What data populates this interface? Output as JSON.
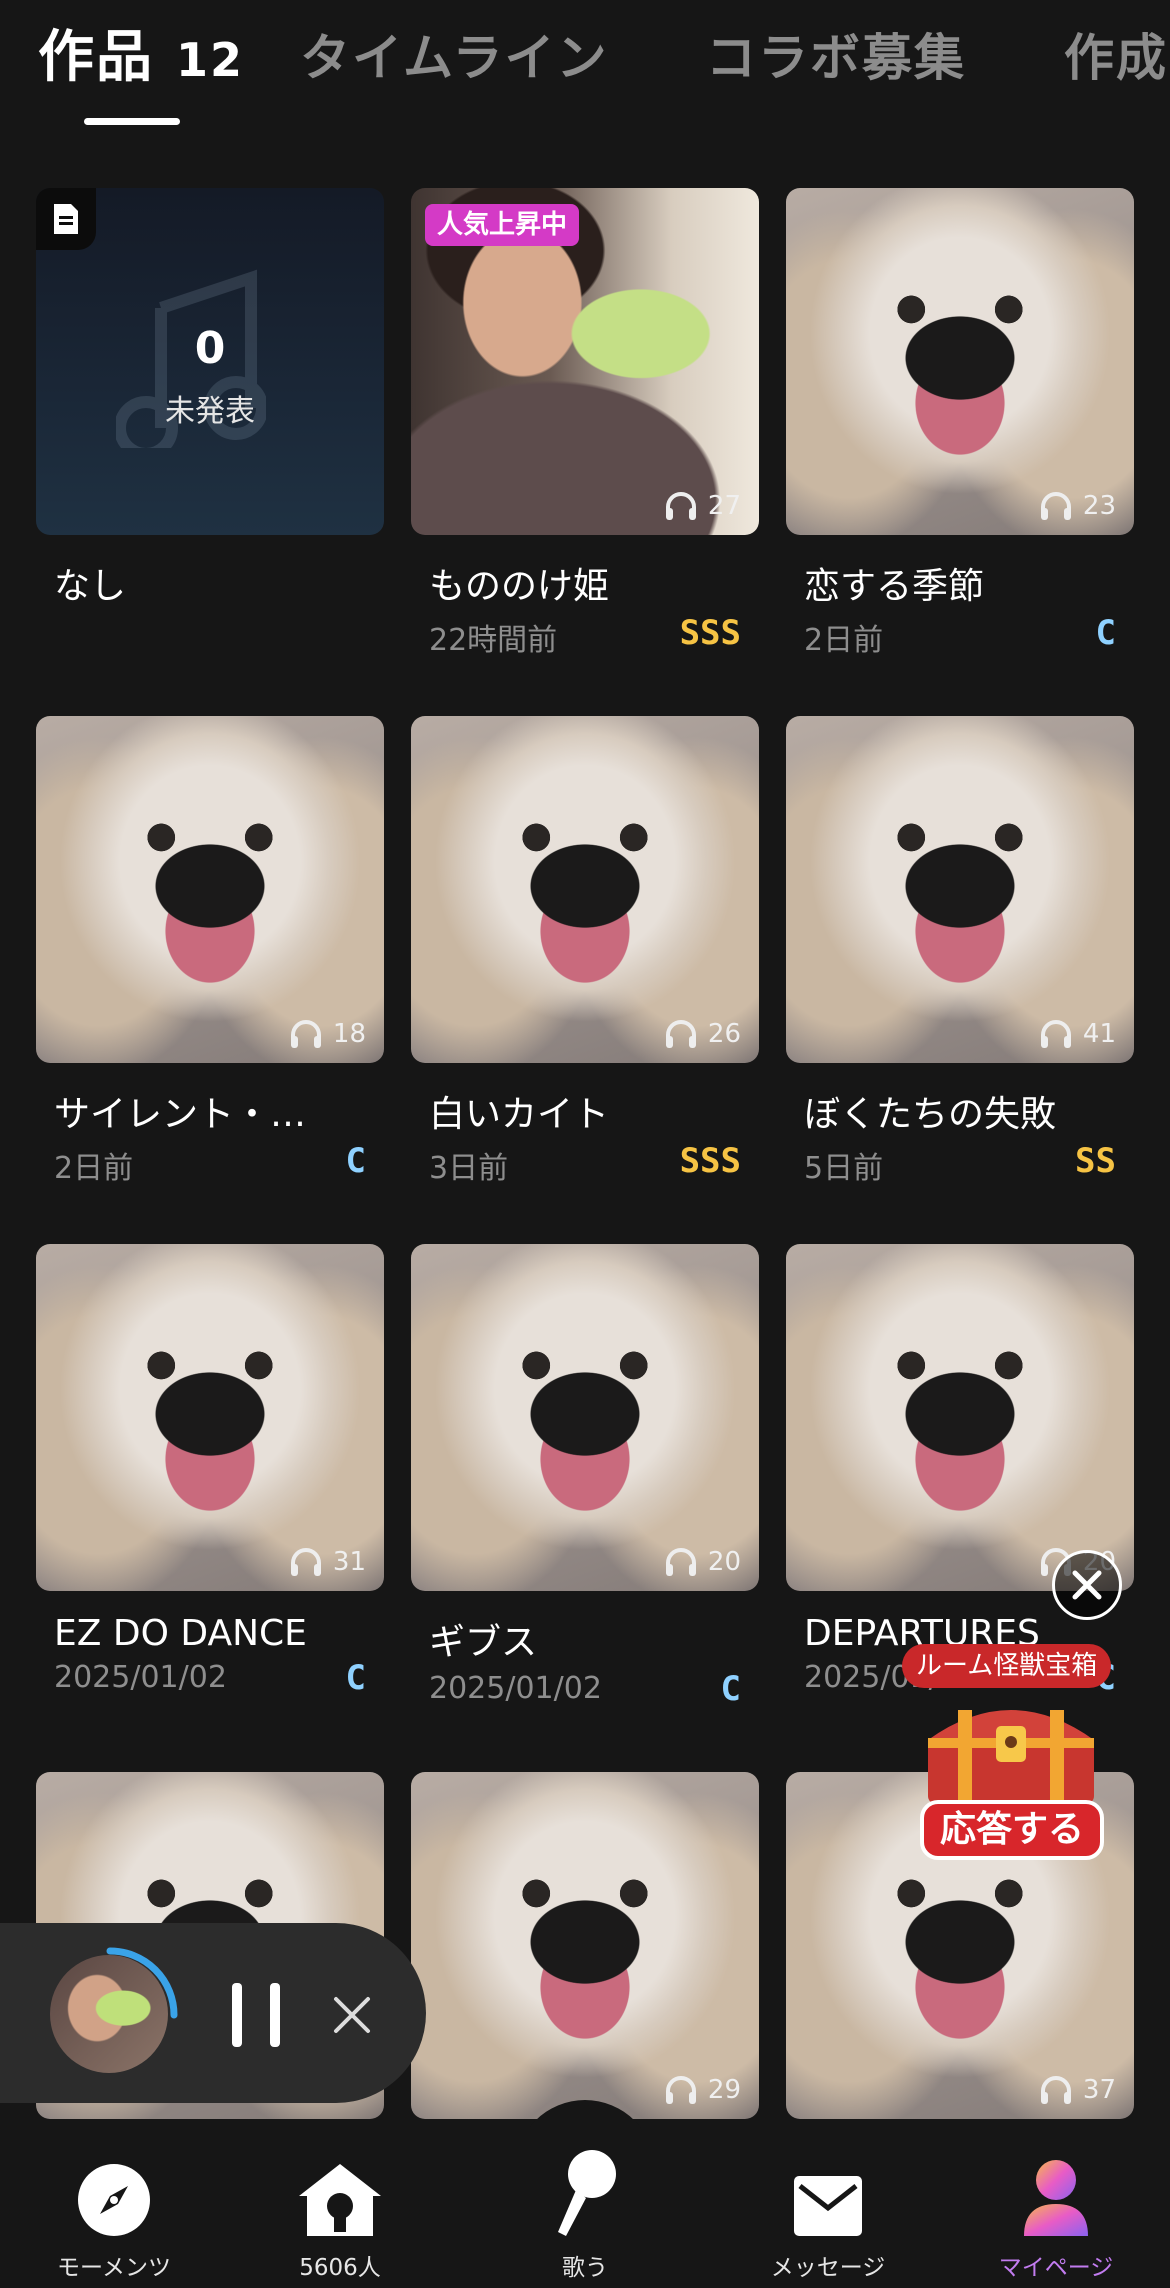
{
  "tabs": {
    "works_label": "作品",
    "works_count": "12",
    "timeline_label": "タイムライン",
    "collab_label": "コラボ募集",
    "create_label": "作成"
  },
  "draft": {
    "count": "0",
    "label": "未発表",
    "title": "なし"
  },
  "trend_badge": "人気上昇中",
  "works": [
    {
      "title": "もののけ姫",
      "date": "22時間前",
      "grade": "SSS",
      "plays": "27"
    },
    {
      "title": "恋する季節",
      "date": "2日前",
      "grade": "C",
      "plays": "23"
    },
    {
      "title": "サイレント・…",
      "date": "2日前",
      "grade": "C",
      "plays": "18"
    },
    {
      "title": "白いカイト",
      "date": "3日前",
      "grade": "SSS",
      "plays": "26"
    },
    {
      "title": "ぼくたちの失敗",
      "date": "5日前",
      "grade": "SS",
      "plays": "41"
    },
    {
      "title": "EZ DO DANCE",
      "date": "2025/01/02",
      "grade": "C",
      "plays": "31"
    },
    {
      "title": "ギブス",
      "date": "2025/01/02",
      "grade": "C",
      "plays": "20"
    },
    {
      "title": "DEPARTURES",
      "date": "2025/01/",
      "grade": "C",
      "plays": "20"
    },
    {
      "title": "",
      "date": "",
      "grade": "",
      "plays": ""
    },
    {
      "title": "",
      "date": "",
      "grade": "",
      "plays": "29"
    },
    {
      "title": "",
      "date": "",
      "grade": "",
      "plays": "37"
    }
  ],
  "colors": {
    "grade_sss": "#f6c344",
    "grade_c": "#8fd1ff",
    "accent": "#c27cf0",
    "trend": "#d43ac6"
  },
  "treasure": {
    "title": "ルーム怪獣宝箱",
    "answer_label": "応答する"
  },
  "nav": {
    "moments": "モーメンツ",
    "room": "5606人",
    "sing": "歌う",
    "messages": "メッセージ",
    "mypage": "マイページ"
  }
}
